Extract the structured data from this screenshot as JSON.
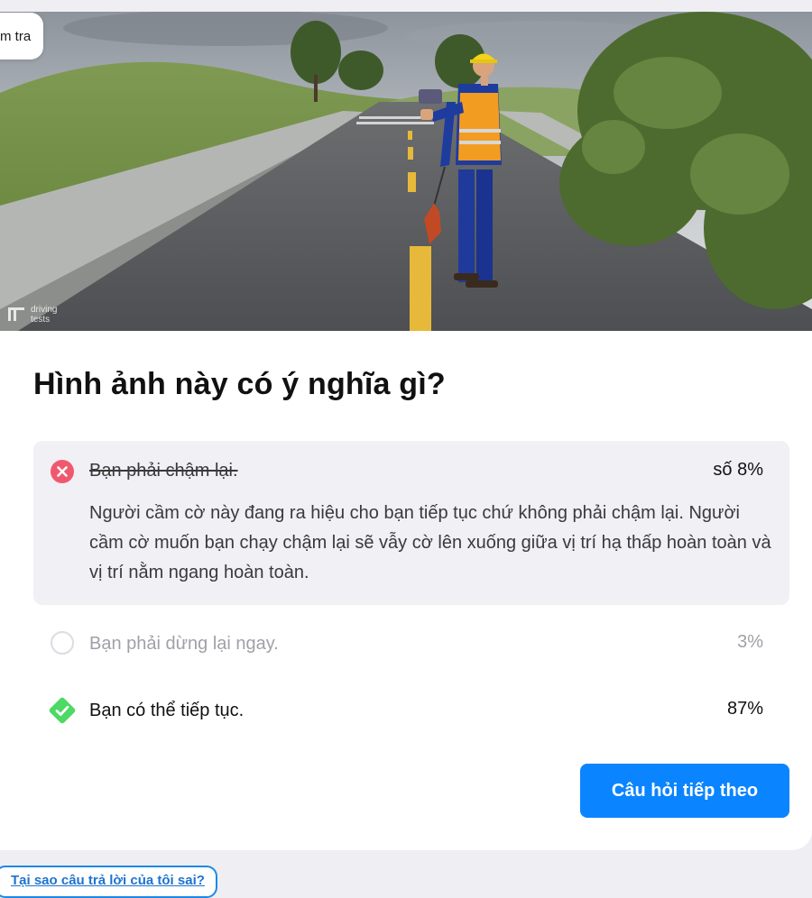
{
  "header": {
    "pill_text": "m tra"
  },
  "image": {
    "watermark_line1": "driving",
    "watermark_line2": "tests"
  },
  "question": {
    "title": "Hình ảnh này có ý nghĩa gì?"
  },
  "options": [
    {
      "label": "Bạn phải chậm lại.",
      "percent": "số 8%",
      "state": "wrong",
      "explanation": "Người cầm cờ này đang ra hiệu cho bạn tiếp tục chứ không phải chậm lại. Người cầm cờ muốn bạn chạy chậm lại sẽ vẫy cờ lên xuống giữa vị trí hạ thấp hoàn toàn và vị trí nằm ngang hoàn toàn.",
      "icon": "x-circle-icon"
    },
    {
      "label": "Bạn phải dừng lại ngay.",
      "percent": "3%",
      "state": "unselected",
      "icon": "empty-circle-icon"
    },
    {
      "label": "Bạn có thể tiếp tục.",
      "percent": "87%",
      "state": "correct",
      "icon": "check-diamond-icon"
    }
  ],
  "actions": {
    "next_label": "Câu hỏi tiếp theo",
    "why_wrong_label": "Tại sao câu trả lời của tôi sai?"
  },
  "colors": {
    "wrong": "#f0596d",
    "correct": "#4cd964",
    "accent": "#0a84ff",
    "panel": "#f0f0f5"
  }
}
